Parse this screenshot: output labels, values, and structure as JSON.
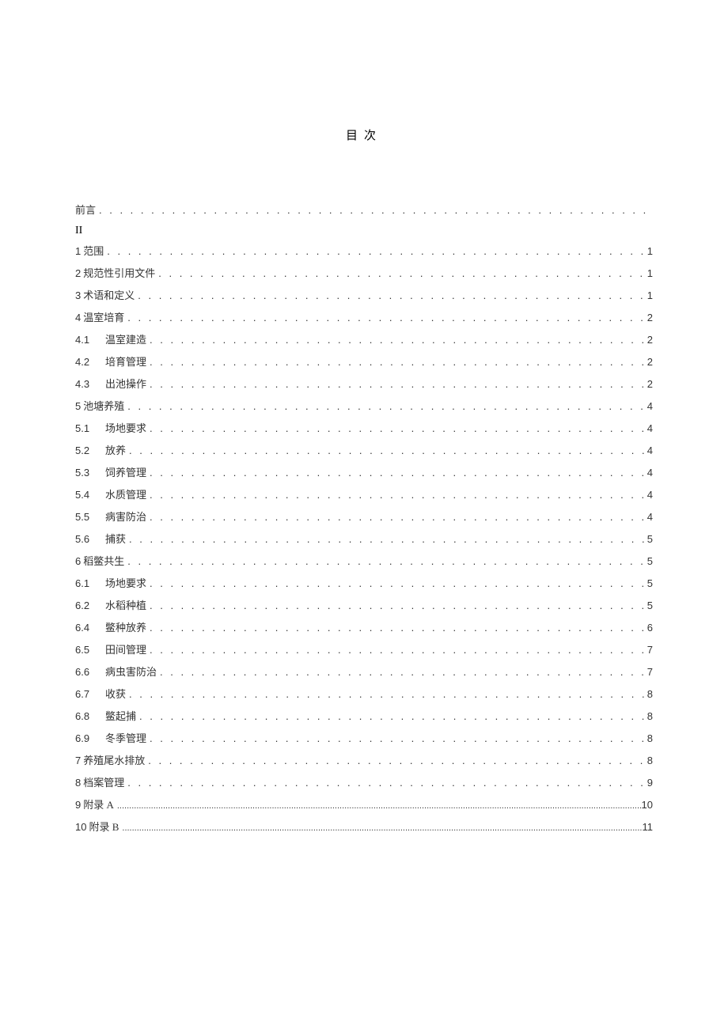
{
  "title": "目次",
  "preface": {
    "label": "前言",
    "continuation": "II"
  },
  "entries": [
    {
      "num": "1",
      "label": "范围",
      "page": "1",
      "level": 1
    },
    {
      "num": "2",
      "label": "规范性引用文件",
      "page": "1",
      "level": 1
    },
    {
      "num": "3",
      "label": "术语和定义",
      "page": "1",
      "level": 1
    },
    {
      "num": "4",
      "label": "温室培育",
      "page": "2",
      "level": 1
    },
    {
      "num": "4.1",
      "label": "温室建造",
      "page": "2",
      "level": 2
    },
    {
      "num": "4.2",
      "label": "培育管理",
      "page": "2",
      "level": 2
    },
    {
      "num": "4.3",
      "label": "出池操作",
      "page": "2",
      "level": 2
    },
    {
      "num": "5",
      "label": "池塘养殖",
      "page": "4",
      "level": 1
    },
    {
      "num": "5.1",
      "label": "场地要求",
      "page": "4",
      "level": 2
    },
    {
      "num": "5.2",
      "label": "放养",
      "page": "4",
      "level": 2
    },
    {
      "num": "5.3",
      "label": "饲养管理",
      "page": "4",
      "level": 2
    },
    {
      "num": "5.4",
      "label": "水质管理",
      "page": "4",
      "level": 2
    },
    {
      "num": "5.5",
      "label": "病害防治",
      "page": "4",
      "level": 2
    },
    {
      "num": "5.6",
      "label": "捕获",
      "page": "5",
      "level": 2
    },
    {
      "num": "6",
      "label": "稻鳖共生",
      "page": "5",
      "level": 1
    },
    {
      "num": "6.1",
      "label": "场地要求",
      "page": "5",
      "level": 2
    },
    {
      "num": "6.2",
      "label": "水稻种植",
      "page": "5",
      "level": 2
    },
    {
      "num": "6.4",
      "label": "鳖种放养",
      "page": "6",
      "level": 2
    },
    {
      "num": "6.5",
      "label": "田间管理",
      "page": "7",
      "level": 2
    },
    {
      "num": "6.6",
      "label": "病虫害防治",
      "page": "7",
      "level": 2
    },
    {
      "num": "6.7",
      "label": "收获",
      "page": "8",
      "level": 2
    },
    {
      "num": "6.8",
      "label": "鳖起捕",
      "page": "8",
      "level": 2
    },
    {
      "num": "6.9",
      "label": "冬季管理",
      "page": "8",
      "level": 2
    },
    {
      "num": "7",
      "label": "养殖尾水排放",
      "page": "8",
      "level": 1
    },
    {
      "num": "8",
      "label": "档案管理",
      "page": "9",
      "level": 1
    },
    {
      "num": "9",
      "label": "附录 A",
      "page": "10",
      "level": 1,
      "thin": true
    },
    {
      "num": "10",
      "label": "附录 B",
      "page": "11",
      "level": 1,
      "thin": true
    }
  ],
  "dots_wide": ". . . . . . . . . . . . . . . . . . . . . . . . . . . . . . . . . . . . . . . . . . . . . . . . . . . . . . . . . . . . . . . . . . . . . . . . . . . . . . . . . . . . . . . . . . . . . . . . . . . . . . . . . . . . . . . . . . . . . . . .",
  "dots_thin": "...................................................................................................................................................................................................................................................................................."
}
